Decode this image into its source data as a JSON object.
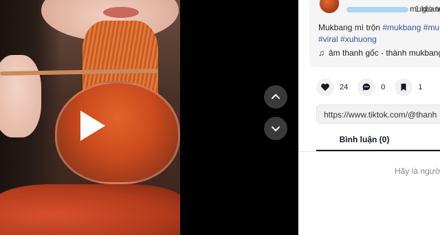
{
  "video": {
    "play_icon": "play-icon",
    "nav_up_icon": "chevron-up-icon",
    "nav_down_icon": "chevron-down-icon"
  },
  "post": {
    "username_suffix": "mukbang",
    "time": "· 1 giờ trư",
    "caption_prefix": "Mukbang mì trộn ",
    "hashtags_line1": [
      "#mukbang",
      "#mu"
    ],
    "hashtags_line2": [
      "#viral",
      "#xuhuong"
    ],
    "music_icon": "♫",
    "music": "âm thanh gốc - thành mukbang"
  },
  "actions": {
    "likes": "24",
    "comments": "0",
    "saves": "1"
  },
  "link": {
    "url": "https://www.tiktok.com/@thanh"
  },
  "comments": {
    "tab_label": "Bình luận (0)",
    "empty_text": "Hãy là người"
  },
  "colors": {
    "hashtag": "#2b5a9e",
    "panel_bg": "#ffffff",
    "nav_btn_bg": "#3a3a3a"
  }
}
